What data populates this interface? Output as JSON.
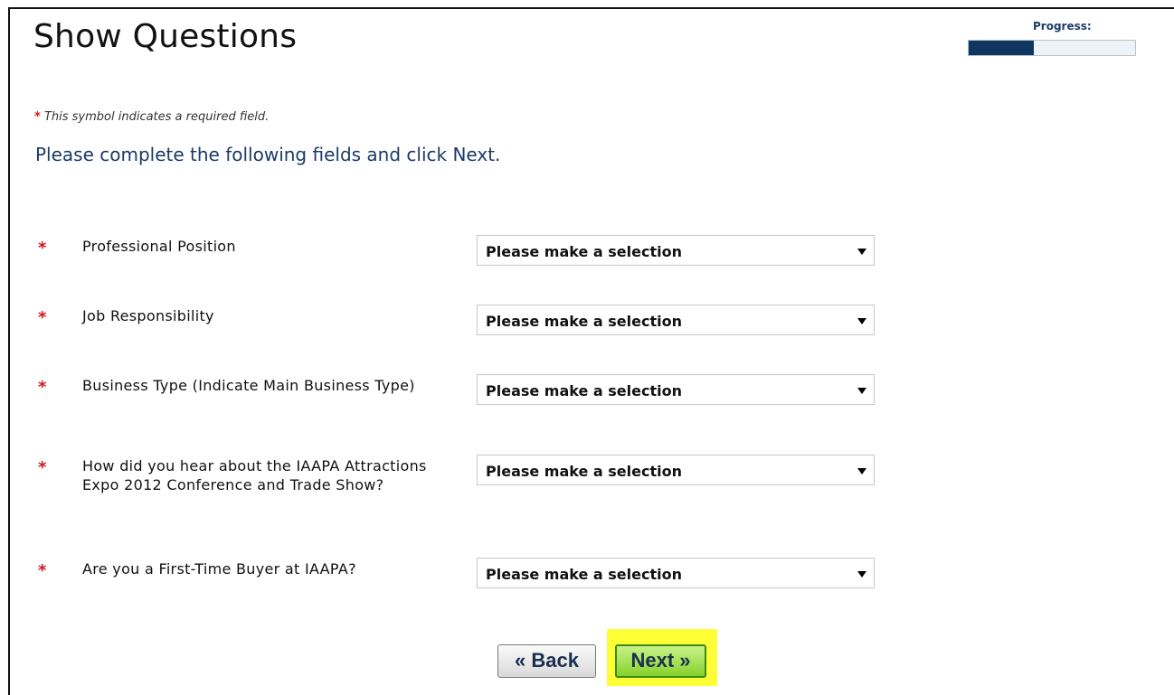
{
  "header": {
    "title": "Show Questions",
    "progress_label": "Progress:",
    "progress_fraction": 0.39
  },
  "required_note": {
    "symbol": "*",
    "text": "This symbol indicates a required field."
  },
  "instructions": "Please complete the following fields and click Next.",
  "questions": [
    {
      "required": "*",
      "label": "Professional Position",
      "selected": "Please make a selection"
    },
    {
      "required": "*",
      "label": "Job Responsibility",
      "selected": "Please make a selection"
    },
    {
      "required": "*",
      "label": "Business Type (Indicate Main Business Type)",
      "selected": "Please make a selection"
    },
    {
      "required": "*",
      "label": "How did you hear about the IAAPA Attractions Expo 2012 Conference and Trade Show?",
      "selected": "Please make a selection"
    },
    {
      "required": "*",
      "label": "Are you a First-Time Buyer at IAAPA?",
      "selected": "Please make a selection"
    }
  ],
  "buttons": {
    "back_label": "« Back",
    "next_label": "Next »"
  },
  "colors": {
    "required_star": "#d8141c",
    "progress_fill": "#0f3560",
    "next_highlight": "#ffff38",
    "next_button": "#86d22a"
  }
}
